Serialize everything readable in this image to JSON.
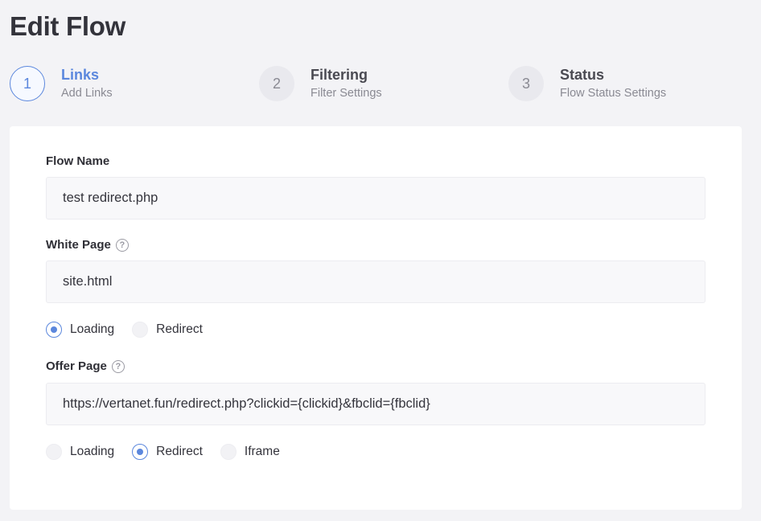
{
  "page": {
    "title": "Edit Flow"
  },
  "stepper": {
    "steps": [
      {
        "number": "1",
        "title": "Links",
        "subtitle": "Add Links"
      },
      {
        "number": "2",
        "title": "Filtering",
        "subtitle": "Filter Settings"
      },
      {
        "number": "3",
        "title": "Status",
        "subtitle": "Flow Status Settings"
      }
    ],
    "active_step": "Links"
  },
  "form": {
    "flow_name": {
      "label": "Flow Name",
      "value": "test redirect.php"
    },
    "white_page": {
      "label": "White Page",
      "help_icon": "?",
      "value": "site.html",
      "modes": [
        {
          "label": "Loading",
          "checked": true
        },
        {
          "label": "Redirect",
          "checked": false
        }
      ]
    },
    "offer_page": {
      "label": "Offer Page",
      "help_icon": "?",
      "value": "https://vertanet.fun/redirect.php?clickid={clickid}&fbclid={fbclid}",
      "modes": [
        {
          "label": "Loading",
          "checked": false
        },
        {
          "label": "Redirect",
          "checked": true
        },
        {
          "label": "Iframe",
          "checked": false
        }
      ]
    }
  },
  "colors": {
    "accent": "#5b87dd",
    "background": "#f3f3f6",
    "card": "#ffffff"
  }
}
